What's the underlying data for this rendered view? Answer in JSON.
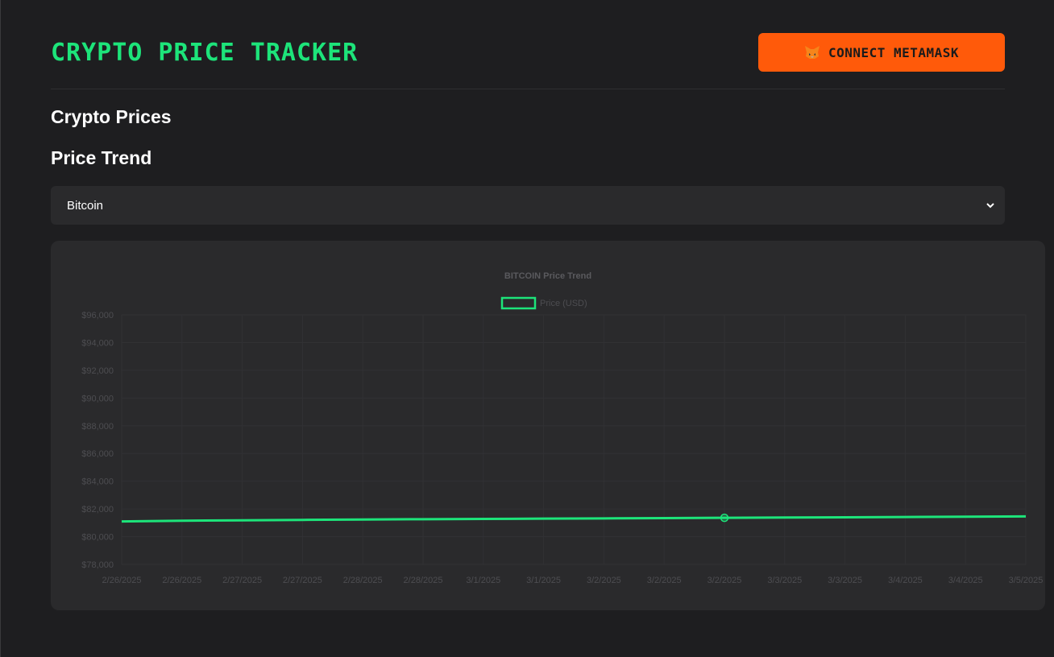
{
  "header": {
    "title": "CRYPTO PRICE TRACKER",
    "connect_label": "CONNECT METAMASK",
    "connect_icon": "metamask-fox-icon"
  },
  "sections": {
    "prices_title": "Crypto Prices",
    "trend_title": "Price Trend"
  },
  "select": {
    "value": "Bitcoin",
    "icon": "chevron-down-icon"
  },
  "colors": {
    "accent": "#1de47a",
    "button": "#ff5a0a",
    "background": "#1e1e20",
    "card": "#2a2a2c"
  },
  "chart_data": {
    "type": "line",
    "title": "BITCOIN Price Trend",
    "legend_position": "top-center",
    "grid": true,
    "ylim": [
      78000,
      96000
    ],
    "y_ticks": [
      "$96,000",
      "$94,000",
      "$92,000",
      "$90,000",
      "$88,000",
      "$86,000",
      "$84,000",
      "$82,000",
      "$80,000",
      "$78,000"
    ],
    "y_tick_values": [
      96000,
      94000,
      92000,
      90000,
      88000,
      86000,
      84000,
      82000,
      80000,
      78000
    ],
    "categories": [
      "2/26/2025",
      "2/26/2025",
      "2/27/2025",
      "2/27/2025",
      "2/28/2025",
      "2/28/2025",
      "3/1/2025",
      "3/1/2025",
      "3/2/2025",
      "3/2/2025",
      "3/2/2025",
      "3/3/2025",
      "3/3/2025",
      "3/4/2025",
      "3/4/2025",
      "3/5/2025"
    ],
    "series": [
      {
        "name": "Price (USD)",
        "color": "#1de47a",
        "values": [
          81100,
          81150,
          81180,
          81210,
          81240,
          81260,
          81280,
          81300,
          81320,
          81340,
          81360,
          81380,
          81400,
          81420,
          81440,
          81460
        ],
        "highlighted_index": 10
      }
    ]
  }
}
